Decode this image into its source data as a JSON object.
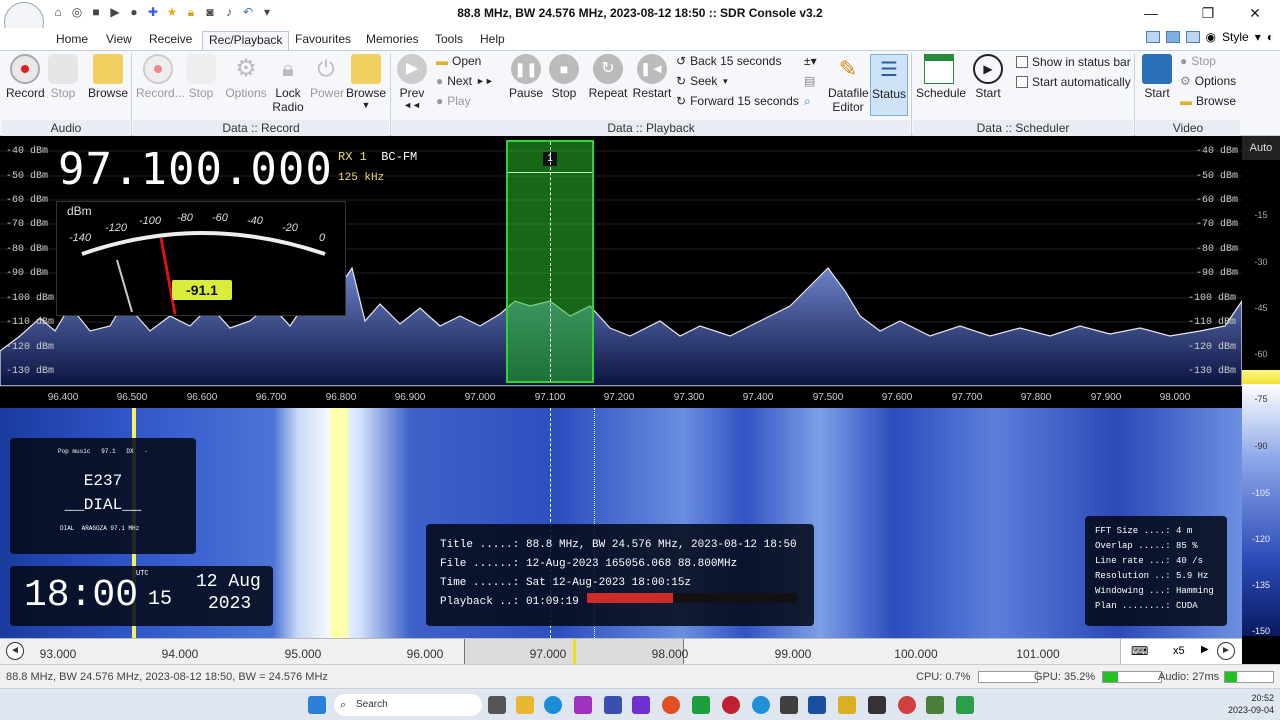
{
  "window": {
    "title": "88.8 MHz, BW 24.576 MHz, 2023-08-12 18:50 :: SDR Console v3.2",
    "controls": [
      "minimize",
      "restore",
      "close"
    ]
  },
  "tabs": [
    "Home",
    "View",
    "Receive",
    "Rec/Playback",
    "Favourites",
    "Memories",
    "Tools",
    "Help"
  ],
  "active_tab": "Rec/Playback",
  "style_label": "Style",
  "ribbon": {
    "audio": {
      "record": "Record",
      "stop": "Stop",
      "browse": "Browse",
      "group": "Audio"
    },
    "data_record": {
      "record": "Record...",
      "stop": "Stop",
      "options": "Options",
      "lock": "Lock",
      "lock2": "Radio",
      "power": "Power",
      "browse": "Browse",
      "group": "Data :: Record"
    },
    "data_playback": {
      "prev": "Prev",
      "open": "Open",
      "next": "Next",
      "play": "Play",
      "pause": "Pause",
      "stop": "Stop",
      "repeat": "Repeat",
      "restart": "Restart",
      "back": "Back 15 seconds",
      "seek": "Seek",
      "forward": "Forward 15 seconds",
      "datafile": "Datafile",
      "editor": "Editor",
      "status": "Status",
      "group": "Data :: Playback"
    },
    "scheduler": {
      "schedule": "Schedule",
      "start": "Start",
      "show_status": "Show in status bar",
      "start_auto": "Start automatically",
      "group": "Data :: Scheduler"
    },
    "video": {
      "start": "Start",
      "stop": "Stop",
      "options": "Options",
      "browse": "Browse",
      "group": "Video"
    }
  },
  "spectrum": {
    "frequency": "97.100.000",
    "rx": "RX 1",
    "mode": "BC-FM",
    "bandwidth": "125 kHz",
    "meter_unit": "dBm",
    "meter_scale": [
      "-140",
      "-120",
      "-100",
      "-80",
      "-60",
      "-40",
      "-20",
      "0"
    ],
    "meter_value": "-91.1",
    "passband_marker": "1",
    "dbm_scale": [
      "-40 dBm",
      "-50 dBm",
      "-60 dBm",
      "-70 dBm",
      "-80 dBm",
      "-90 dBm",
      "-100 dBm",
      "-110 dBm",
      "-120 dBm",
      "-130 dBm"
    ],
    "auto": "Auto",
    "right_scale": [
      "-15",
      "-30",
      "-45",
      "-60",
      "-75",
      "-90",
      "-105",
      "-120",
      "-135",
      "-150"
    ],
    "freq_axis": [
      "96.400",
      "96.500",
      "96.600",
      "96.700",
      "96.800",
      "96.900",
      "97.000",
      "97.100",
      "97.200",
      "97.300",
      "97.400",
      "97.500",
      "97.600",
      "97.700",
      "97.800",
      "97.900",
      "98.000"
    ]
  },
  "rds": {
    "top": "Pop music   97.1   DX   -",
    "ps": "E237",
    "ps2": "__DIAL__",
    "bottom": "DIAL  ARAGOZA 97.1 MHz"
  },
  "clock": {
    "time": "18:00",
    "seconds": "15",
    "tz": "UTC",
    "date": "12 Aug",
    "year": "2023"
  },
  "info": {
    "rows": [
      {
        "k": "Title .....:",
        "v": "88.8 MHz, BW 24.576 MHz, 2023-08-12 18:50"
      },
      {
        "k": "File ......:",
        "v": "12-Aug-2023 165056.068 88.800MHz"
      },
      {
        "k": "Time ......:",
        "v": "Sat 12-Aug-2023 18:00:15z"
      }
    ],
    "playback_key": "Playback ..:",
    "playback_val": "01:09:19",
    "playback_progress": 0.41
  },
  "fft": [
    {
      "k": "FFT Size ....:",
      "v": "4 m"
    },
    {
      "k": "Overlap .....:",
      "v": "85 %"
    },
    {
      "k": "Line rate ...:",
      "v": "40 /s"
    },
    {
      "k": "Resolution ..:",
      "v": "5.9 Hz"
    },
    {
      "k": "Windowing ...:",
      "v": "Hamming"
    },
    {
      "k": "Plan ........:",
      "v": "CUDA"
    }
  ],
  "bottom_axis": [
    "93.000",
    "94.000",
    "95.000",
    "96.000",
    "97.000",
    "98.000",
    "99.000",
    "100.000",
    "101.000"
  ],
  "zoom": "x5",
  "status": {
    "text": "88.8 MHz, BW 24.576 MHz, 2023-08-12 18:50, BW = 24.576 MHz",
    "cpu": "CPU: 0.7%",
    "gpu": "GPU: 35.2%",
    "audio": "Audio: 27ms",
    "gpu_level": 0.25,
    "audio_level": 0.25
  },
  "taskbar": {
    "search": "Search",
    "time": "20:52",
    "date": "2023-09-04"
  }
}
